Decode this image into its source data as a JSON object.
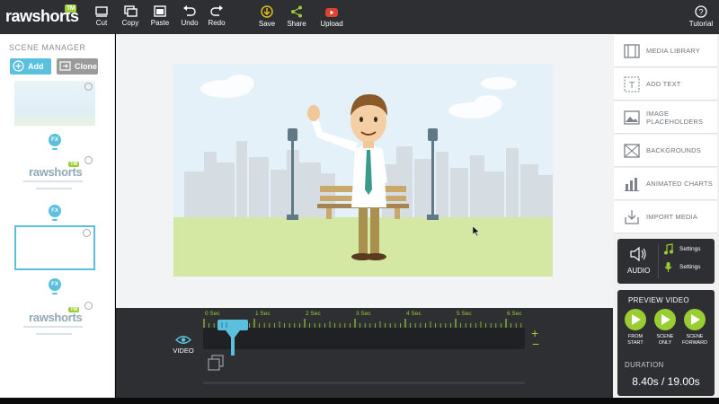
{
  "app": {
    "logo_text": "rawshorts",
    "logo_badge": "TM"
  },
  "toolbar": {
    "cut": "Cut",
    "copy": "Copy",
    "paste": "Paste",
    "undo": "Undo",
    "redo": "Redo",
    "save": "Save",
    "share": "Share",
    "upload": "Upload",
    "tutorial": "Tutorial"
  },
  "scene_manager": {
    "title": "SCENE MANAGER",
    "add_label": "Add",
    "clone_label": "Clone",
    "fx_label": "FX",
    "thumb_logo": "rawshorts",
    "thumb_badge": "TM"
  },
  "timeline": {
    "track_label": "VIDEO",
    "ticks": [
      "0 Sec",
      "1 Sec",
      "2 Sec",
      "3 Sec",
      "4 Sec",
      "5 Sec",
      "6 Sec"
    ],
    "zoom_in": "+",
    "zoom_out": "−"
  },
  "library": {
    "items": [
      {
        "label": "MEDIA LIBRARY",
        "icon": "film-icon"
      },
      {
        "label": "ADD TEXT",
        "icon": "text-icon"
      },
      {
        "label_line1": "IMAGE",
        "label_line2": "PLACEHOLDERS",
        "icon": "image-icon"
      },
      {
        "label": "BACKGROUNDS",
        "icon": "background-icon"
      },
      {
        "label": "ANIMATED CHARTS",
        "icon": "chart-icon"
      },
      {
        "label": "IMPORT MEDIA",
        "icon": "import-icon"
      }
    ]
  },
  "audio": {
    "label": "AUDIO",
    "music_settings": "Settings",
    "voice_settings": "Settings"
  },
  "preview": {
    "title": "PREVIEW VIDEO",
    "from_start_line1": "FROM",
    "from_start_line2": "START",
    "scene_only_line1": "SCENE",
    "scene_only_line2": "ONLY",
    "scene_forward_line1": "SCENE",
    "scene_forward_line2": "FORWARD",
    "duration_label": "DURATION",
    "duration_value": "8.40s / 19.00s"
  },
  "colors": {
    "toolbar_bg": "#2d2f33",
    "accent_green": "#9acd32",
    "accent_blue": "#5bc0de",
    "upload_red": "#e0412f",
    "save_yellow": "#e8c31a"
  }
}
